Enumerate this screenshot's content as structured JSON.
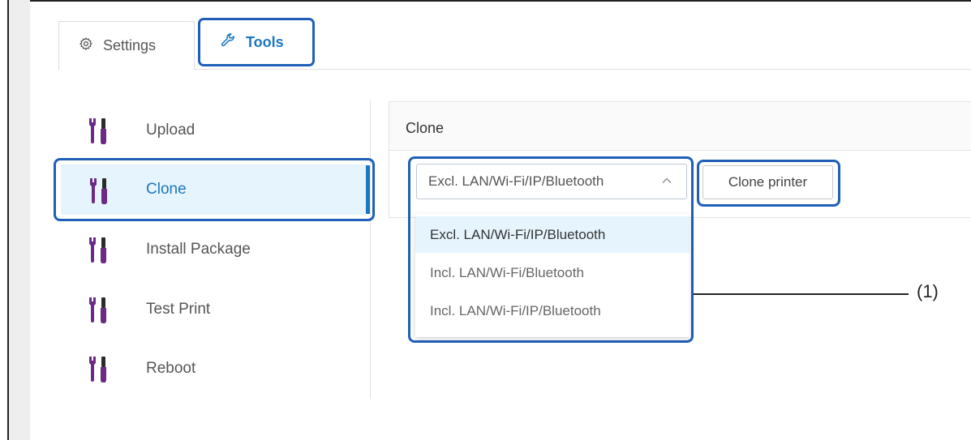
{
  "tabs": [
    {
      "label": "Settings",
      "icon": "gear-icon"
    },
    {
      "label": "Tools",
      "icon": "wrench-icon"
    }
  ],
  "sidebar": {
    "items": [
      {
        "label": "Upload",
        "icon": "tools-icon"
      },
      {
        "label": "Clone",
        "icon": "tools-icon",
        "active": true
      },
      {
        "label": "Install Package",
        "icon": "tools-icon"
      },
      {
        "label": "Test Print",
        "icon": "tools-icon"
      },
      {
        "label": "Reboot",
        "icon": "tools-icon"
      }
    ]
  },
  "panel": {
    "title": "Clone",
    "select": {
      "value": "Excl. LAN/Wi-Fi/IP/Bluetooth",
      "options": [
        "Excl. LAN/Wi-Fi/IP/Bluetooth",
        "Incl. LAN/Wi-Fi/Bluetooth",
        "Incl. LAN/Wi-Fi/IP/Bluetooth"
      ]
    },
    "clone_button": "Clone printer"
  },
  "callout": "(1)",
  "colors": {
    "accent": "#1a78c2",
    "highlight": "#1f5fb8",
    "selected_bg": "#e6f4fd",
    "icon_purple": "#6b2a86"
  }
}
